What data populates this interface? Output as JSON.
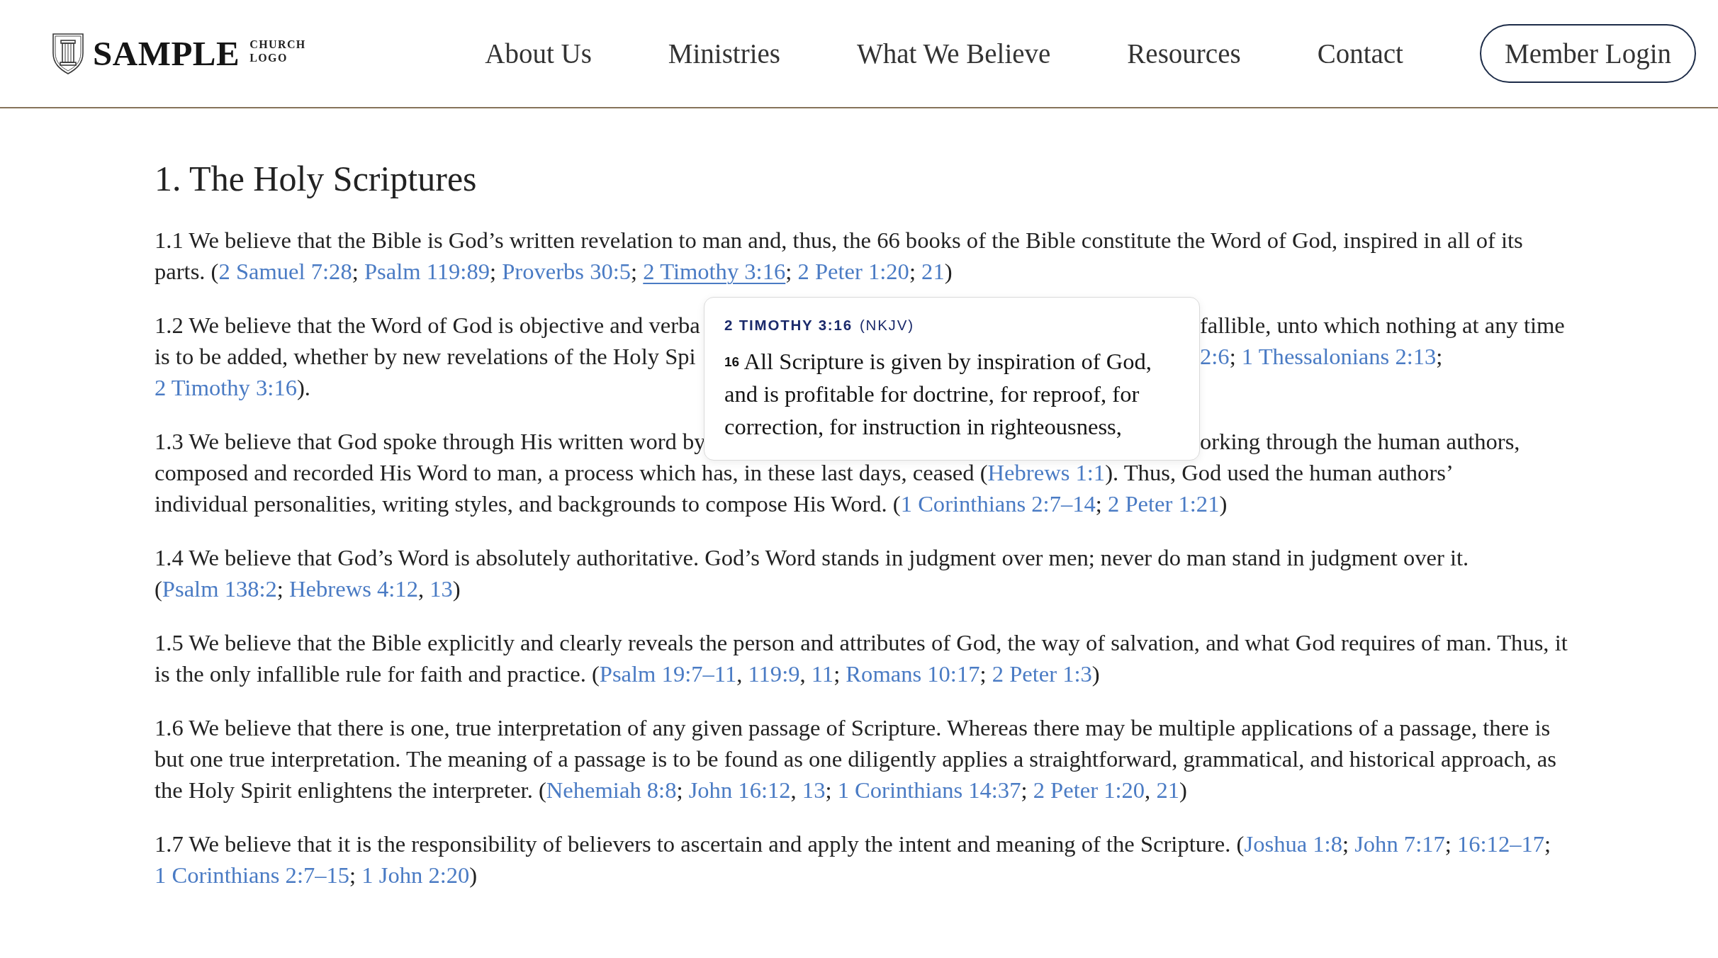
{
  "header": {
    "logo": {
      "wordmark": "SAMPLE",
      "tagline": [
        "CHURCH",
        "LOGO"
      ]
    },
    "nav": [
      "About Us",
      "Ministries",
      "What We Believe",
      "Resources",
      "Contact"
    ],
    "login_button": "Member Login"
  },
  "article": {
    "heading": "1. The Holy Scriptures",
    "paragraphs": [
      {
        "kind": "flow",
        "segments": [
          {
            "kind": "text",
            "text": "1.1 We believe that the Bible is God’s written revelation to man and, thus, the 66 books of the Bible constitute the Word of God, inspired in all of its parts. ("
          },
          {
            "kind": "link",
            "text": "2 Samuel 7:28",
            "hovered": false
          },
          {
            "kind": "text",
            "text": "; "
          },
          {
            "kind": "link",
            "text": "Psalm 119:89",
            "hovered": false
          },
          {
            "kind": "text",
            "text": "; "
          },
          {
            "kind": "link",
            "text": "Proverbs 30:5",
            "hovered": false
          },
          {
            "kind": "text",
            "text": "; "
          },
          {
            "kind": "link",
            "text": "2 Timothy 3:16",
            "hovered": true
          },
          {
            "kind": "text",
            "text": "; "
          },
          {
            "kind": "link",
            "text": "2 Peter 1:20",
            "hovered": false
          },
          {
            "kind": "text",
            "text": "; "
          },
          {
            "kind": "link",
            "text": "21",
            "hovered": false
          },
          {
            "kind": "text",
            "text": ")"
          }
        ]
      },
      {
        "kind": "lines",
        "lines": [
          {
            "left": [
              {
                "kind": "text",
                "text": "1.2 We believe that the Word of God is objective and verba"
              }
            ],
            "right": [
              {
                "kind": "text",
                "text": "fallible, unto which nothing at any time"
              }
            ]
          },
          {
            "left": [
              {
                "kind": "text",
                "text": "is to be added, whether by new revelations of the Holy Spi"
              }
            ],
            "right": [
              {
                "kind": "link",
                "text": "2:6",
                "hovered": false
              },
              {
                "kind": "text",
                "text": "; "
              },
              {
                "kind": "link",
                "text": "1 Thessalonians 2:13",
                "hovered": false
              },
              {
                "kind": "text",
                "text": ";"
              }
            ]
          },
          {
            "left": [
              {
                "kind": "link",
                "text": "2 Timothy 3:16",
                "hovered": false
              },
              {
                "kind": "text",
                "text": ")."
              }
            ]
          }
        ]
      },
      {
        "kind": "lines",
        "lines": [
          {
            "left": [
              {
                "kind": "text",
                "text": "1.3 We believe that God spoke through His written word by"
              }
            ],
            "right": [
              {
                "kind": "text",
                "text": "orking through the human authors,"
              }
            ]
          },
          {
            "left": [
              {
                "kind": "text",
                "text": "composed and recorded His Word to man, a process which has, in these last days, ceased ("
              },
              {
                "kind": "link",
                "text": "Hebrews 1:1",
                "hovered": false
              },
              {
                "kind": "text",
                "text": "). Thus, God used the human authors’"
              }
            ]
          },
          {
            "left": [
              {
                "kind": "text",
                "text": "individual personalities, writing styles, and backgrounds to compose His Word. ("
              },
              {
                "kind": "link",
                "text": "1 Corinthians 2:7–14",
                "hovered": false
              },
              {
                "kind": "text",
                "text": "; "
              },
              {
                "kind": "link",
                "text": "2 Peter 1:21",
                "hovered": false
              },
              {
                "kind": "text",
                "text": ")"
              }
            ]
          }
        ]
      },
      {
        "kind": "flow",
        "segments": [
          {
            "kind": "text",
            "text": "1.4 We believe that God’s Word is absolutely authoritative. God’s Word stands in judgment over men; never do man stand in judgment over it. ("
          },
          {
            "kind": "link",
            "text": "Psalm 138:2",
            "hovered": false
          },
          {
            "kind": "text",
            "text": "; "
          },
          {
            "kind": "link",
            "text": "Hebrews 4:12",
            "hovered": false
          },
          {
            "kind": "text",
            "text": ", "
          },
          {
            "kind": "link",
            "text": "13",
            "hovered": false
          },
          {
            "kind": "text",
            "text": ")"
          }
        ]
      },
      {
        "kind": "flow",
        "segments": [
          {
            "kind": "text",
            "text": "1.5 We believe that the Bible explicitly and clearly reveals the person and attributes of God, the way of salvation, and what God requires of man. Thus, it is the only infallible rule for faith and practice. ("
          },
          {
            "kind": "link",
            "text": "Psalm 19:7–11",
            "hovered": false
          },
          {
            "kind": "text",
            "text": ", "
          },
          {
            "kind": "link",
            "text": "119:9",
            "hovered": false
          },
          {
            "kind": "text",
            "text": ", "
          },
          {
            "kind": "link",
            "text": "11",
            "hovered": false
          },
          {
            "kind": "text",
            "text": "; "
          },
          {
            "kind": "link",
            "text": "Romans 10:17",
            "hovered": false
          },
          {
            "kind": "text",
            "text": "; "
          },
          {
            "kind": "link",
            "text": "2 Peter 1:3",
            "hovered": false
          },
          {
            "kind": "text",
            "text": ")"
          }
        ]
      },
      {
        "kind": "flow",
        "segments": [
          {
            "kind": "text",
            "text": "1.6 We believe that there is one, true interpretation of any given passage of Scripture. Whereas there may be multiple applications of a passage, there is but one true interpretation. The meaning of a passage is to be found as one diligently applies a straightforward, grammatical, and historical approach, as the Holy Spirit enlightens the interpreter. ("
          },
          {
            "kind": "link",
            "text": "Nehemiah 8:8",
            "hovered": false
          },
          {
            "kind": "text",
            "text": "; "
          },
          {
            "kind": "link",
            "text": "John 16:12",
            "hovered": false
          },
          {
            "kind": "text",
            "text": ", "
          },
          {
            "kind": "link",
            "text": "13",
            "hovered": false
          },
          {
            "kind": "text",
            "text": "; "
          },
          {
            "kind": "link",
            "text": "1 Corinthians 14:37",
            "hovered": false
          },
          {
            "kind": "text",
            "text": "; "
          },
          {
            "kind": "link",
            "text": "2 Peter 1:20",
            "hovered": false
          },
          {
            "kind": "text",
            "text": ", "
          },
          {
            "kind": "link",
            "text": "21",
            "hovered": false
          },
          {
            "kind": "text",
            "text": ")"
          }
        ]
      },
      {
        "kind": "flow",
        "segments": [
          {
            "kind": "text",
            "text": "1.7 We believe that it is the responsibility of believers to ascertain and apply the intent and meaning of the Scripture. ("
          },
          {
            "kind": "link",
            "text": "Joshua 1:8",
            "hovered": false
          },
          {
            "kind": "text",
            "text": "; "
          },
          {
            "kind": "link",
            "text": "John 7:17",
            "hovered": false
          },
          {
            "kind": "text",
            "text": "; "
          },
          {
            "kind": "link",
            "text": "16:12–17",
            "hovered": false
          },
          {
            "kind": "text",
            "text": "; "
          },
          {
            "kind": "link",
            "text": "1 Corinthians 2:7–15",
            "hovered": false
          },
          {
            "kind": "text",
            "text": "; "
          },
          {
            "kind": "link",
            "text": "1 John 2:20",
            "hovered": false
          },
          {
            "kind": "text",
            "text": ")"
          }
        ]
      }
    ]
  },
  "tooltip": {
    "reference": "2 TIMOTHY 3:16",
    "version": "(NKJV)",
    "verse_number": "16",
    "text": "All Scripture is given by inspiration of God, and is profitable for doctrine, for reproof, for correction, for instruction in righteousness,"
  }
}
